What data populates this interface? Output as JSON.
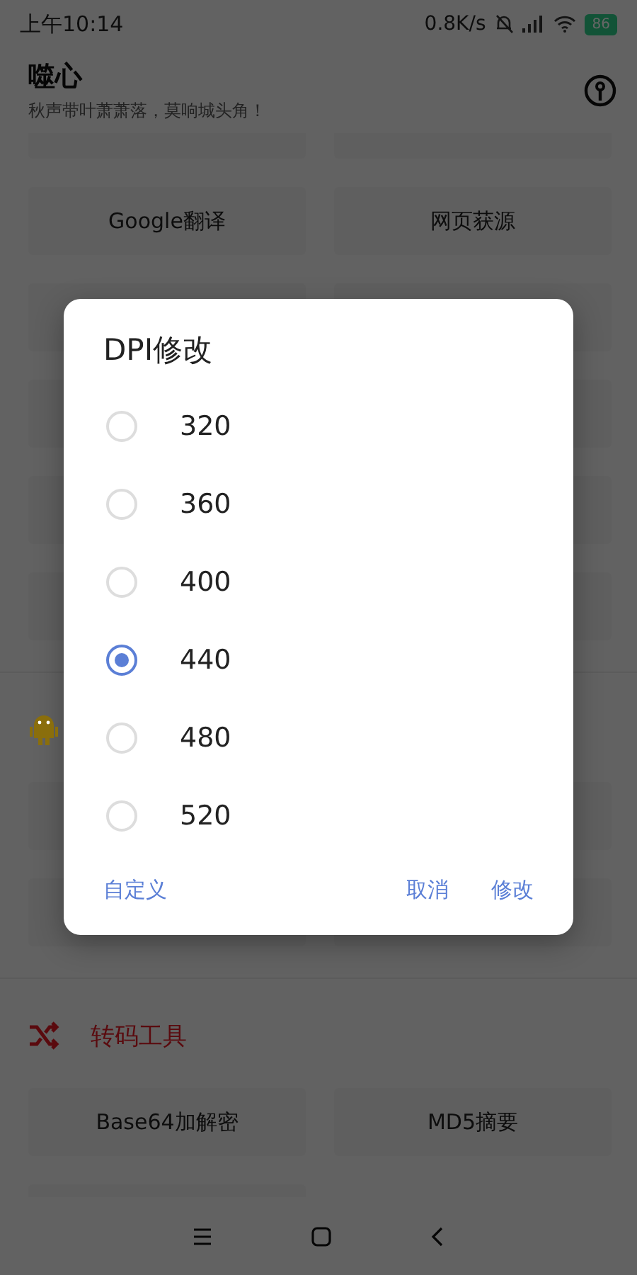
{
  "status_bar": {
    "time": "上午10:14",
    "net_speed": "0.8K/s",
    "battery": "86"
  },
  "header": {
    "title": "噬心",
    "subtitle": "秋声带叶萧萧落，莫响城头角！"
  },
  "sections": [
    {
      "kind": "plain",
      "cards": [
        {
          "kind": "partial"
        },
        {
          "kind": "partial"
        },
        {
          "kind": "labeled",
          "label": "Google翻译"
        },
        {
          "kind": "labeled",
          "label": "网页获源"
        },
        {
          "kind": "blank"
        },
        {
          "kind": "blank"
        },
        {
          "kind": "blank"
        },
        {
          "kind": "blank"
        },
        {
          "kind": "blank"
        },
        {
          "kind": "blank"
        },
        {
          "kind": "blank"
        },
        {
          "kind": "blank"
        }
      ]
    },
    {
      "kind": "android",
      "color": "#8a6e0c",
      "cards": [
        {
          "kind": "blank"
        },
        {
          "kind": "blank"
        },
        {
          "kind": "blank"
        },
        {
          "kind": "blank"
        }
      ]
    },
    {
      "kind": "shuffle",
      "color": "#5a0a0e",
      "title": "转码工具",
      "cards": [
        {
          "kind": "labeled",
          "label": "Base64加解密"
        },
        {
          "kind": "labeled",
          "label": "MD5摘要"
        },
        {
          "kind": "partial"
        }
      ]
    }
  ],
  "dialog": {
    "title": "DPI修改",
    "options": [
      {
        "label": "320",
        "selected": false
      },
      {
        "label": "360",
        "selected": false
      },
      {
        "label": "400",
        "selected": false
      },
      {
        "label": "440",
        "selected": true
      },
      {
        "label": "480",
        "selected": false
      },
      {
        "label": "520",
        "selected": false
      }
    ],
    "buttons": [
      {
        "label": "自定义",
        "kind": "neutral"
      },
      {
        "label": "取消",
        "kind": "negative"
      },
      {
        "label": "修改",
        "kind": "positive"
      }
    ]
  }
}
